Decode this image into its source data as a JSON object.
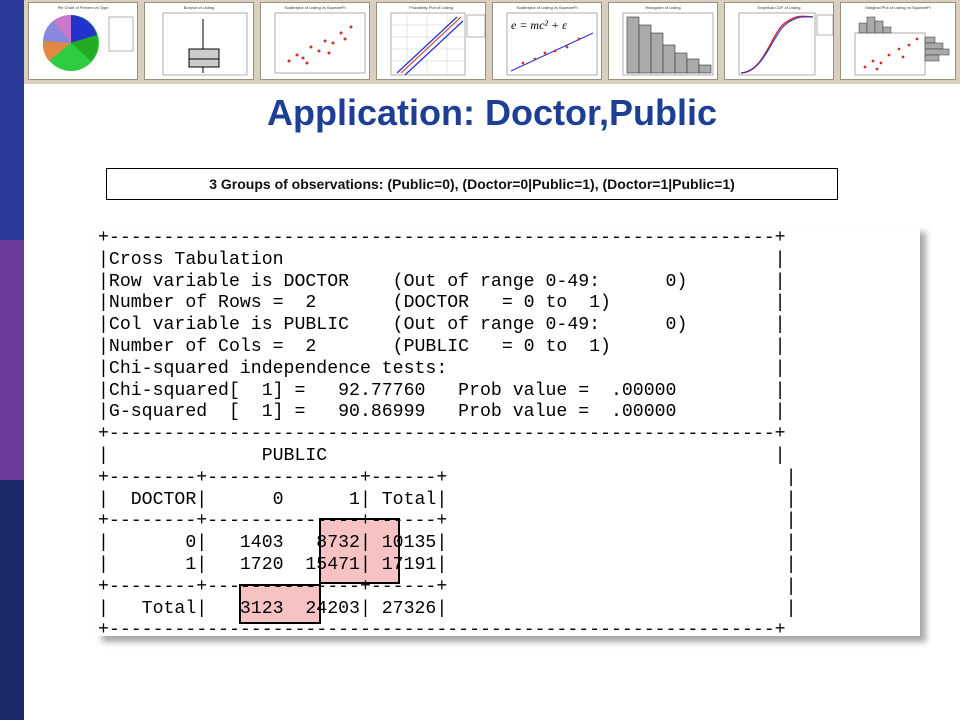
{
  "slide": {
    "title": "Application: Doctor,Public",
    "groups_note": "3 Groups of observations: (Public=0), (Doctor=0|Public=1), (Doctor=1|Public=1)",
    "colors": {
      "title": "#1c3f95",
      "bar_top": "#2b3a9a",
      "bar_mid": "#6c3a9a",
      "bar_bottom": "#1c2a6a",
      "highlight": "#f7c2c2"
    }
  },
  "thumbnails": [
    {
      "caption": "Pie Chart of Percent vs Type",
      "icon": "pie-chart-thumbnail"
    },
    {
      "caption": "Boxplot of Listing",
      "icon": "boxplot-thumbnail"
    },
    {
      "caption": "Scatterplot of Listing vs SqueareFt",
      "icon": "scatter-thumbnail"
    },
    {
      "caption": "Probability Plot of Listing",
      "icon": "probability-plot-thumbnail"
    },
    {
      "caption": "Scatterplot of Listing vs SqueareFt",
      "icon": "regression-thumbnail",
      "formula": "e = mc² + ε"
    },
    {
      "caption": "Histogram of Listing",
      "icon": "histogram-thumbnail"
    },
    {
      "caption": "Empirical CDF of Listing",
      "icon": "cdf-thumbnail"
    },
    {
      "caption": "Marginal Plot of Listing vs SqueareFt",
      "icon": "marginal-plot-thumbnail"
    }
  ],
  "console_lines": [
    "+-------------------------------------------------------------+",
    "|Cross Tabulation                                             |",
    "|Row variable is DOCTOR    (Out of range 0-49:      0)        |",
    "|Number of Rows =  2       (DOCTOR   = 0 to  1)               |",
    "|Col variable is PUBLIC    (Out of range 0-49:      0)        |",
    "|Number of Cols =  2       (PUBLIC   = 0 to  1)               |",
    "|Chi-squared independence tests:                              |",
    "|Chi-squared[  1] =   92.77760   Prob value =  .00000         |",
    "|G-squared  [  1] =   90.86999   Prob value =  .00000         |",
    "+-------------------------------------------------------------+",
    "|              PUBLIC                                         |",
    "+--------+--------------+------+                               |",
    "|  DOCTOR|      0      1| Total|                               |",
    "+--------+--------------+------+                               |",
    "|       0|   1403   8732| 10135|                               |",
    "|       1|   1720  15471| 17191|                               |",
    "+--------+--------------+------+                               |",
    "|   Total|   3123  24203| 27326|                               |",
    "+-------------------------------------------------------------+"
  ]
}
